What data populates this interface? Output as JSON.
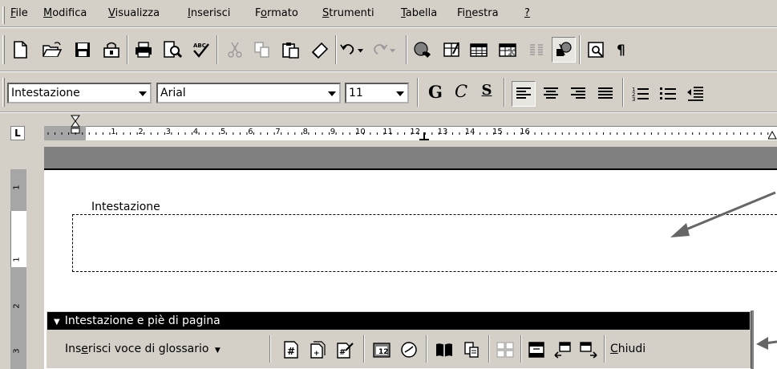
{
  "menu": {
    "items": [
      {
        "label": "File",
        "accel": "F",
        "rest": "ile"
      },
      {
        "label": "Modifica",
        "accel": "M",
        "rest": "odifica"
      },
      {
        "label": "Visualizza",
        "accel": "V",
        "rest": "isualizza"
      },
      {
        "label": "Inserisci",
        "accel": "I",
        "rest": "nserisci"
      },
      {
        "label": "Formato",
        "accel": "o",
        "pre": "F",
        "rest": "rmato"
      },
      {
        "label": "Strumenti",
        "accel": "S",
        "rest": "trumenti"
      },
      {
        "label": "Tabella",
        "accel": "T",
        "rest": "abella"
      },
      {
        "label": "Finestra",
        "accel": "n",
        "pre": "Fi",
        "rest": "estra"
      },
      {
        "label": "?",
        "accel": "?",
        "rest": ""
      }
    ]
  },
  "formatting": {
    "style": "Intestazione",
    "font": "Arial",
    "size": "11",
    "bold": "G",
    "italic": "C",
    "underline": "S"
  },
  "ruler": {
    "numbers": [
      "1",
      "2",
      "3",
      "4",
      "5",
      "6",
      "7",
      "8",
      "9",
      "10",
      "11",
      "12",
      "13",
      "14",
      "15",
      "16"
    ],
    "tab_selector": "L"
  },
  "vruler": {
    "numbers": [
      "1",
      "1",
      "2",
      "3"
    ]
  },
  "document": {
    "header_label": "Intestazione"
  },
  "header_toolbar": {
    "title": "Intestazione e piè di pagina",
    "insert_autotext_pre": "Ins",
    "insert_autotext_accel": "e",
    "insert_autotext_rest": "risci voce di glossario",
    "close_accel": "C",
    "close_rest": "hiudi"
  }
}
